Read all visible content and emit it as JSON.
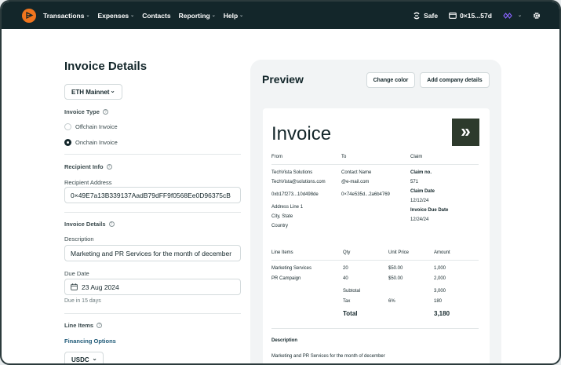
{
  "nav": {
    "items": [
      {
        "label": "Transactions"
      },
      {
        "label": "Expenses"
      },
      {
        "label": "Contacts"
      },
      {
        "label": "Reporting"
      },
      {
        "label": "Help"
      }
    ],
    "safe_label": "Safe",
    "wallet_label": "0×15...57d",
    "icons": [
      "logo-icon",
      "safe-icon",
      "wallet-icon",
      "chain-icon",
      "gear-icon"
    ],
    "accent": "#f0751e",
    "bar_color": "#13262a"
  },
  "form": {
    "title": "Invoice Details",
    "network": "ETH Mainnet",
    "invoice_type_label": "Invoice Type",
    "invoice_type_options": [
      "Offchain Invoice",
      "Onchain Invoice"
    ],
    "invoice_type_selected": "Onchain Invoice",
    "recipient_info_label": "Recipient Info",
    "recipient_address_label": "Recipient Address",
    "recipient_address": "0×49E7a13B339137AadB79dFF9f0568Ee0D96375cB",
    "invoice_details_label": "Invoice Details",
    "description_label": "Description",
    "description": "Marketing and PR Services for the month of december",
    "due_date_label": "Due Date",
    "due_date": "23 Aug 2024",
    "due_hint": "Due in 15 days",
    "line_items_label": "Line Items",
    "financing_label": "Financing Options",
    "currency": "USDC"
  },
  "preview": {
    "title": "Preview",
    "change_color": "Change color",
    "add_company": "Add company details",
    "invoice_heading": "Invoice",
    "from_label": "From",
    "to_label": "To",
    "claim_label": "Claim",
    "from": {
      "name": "TechVista Solutions",
      "email": "TechVista@solutions.com",
      "address": "0xb17f273...10d498de",
      "line1": "Address Line 1",
      "city": "City, State",
      "country": "Country"
    },
    "to": {
      "name": "Contact Name",
      "email": "@e-mail.com",
      "address": "0×74e535d...2a6b4769"
    },
    "claim": {
      "no_label": "Claim no.",
      "no": "571",
      "date_label": "Claim Date",
      "date": "12/12/24",
      "due_label": "Invoice Due Date",
      "due": "12/24/24"
    },
    "table": {
      "headers": [
        "Line Items",
        "Qty",
        "Unit Price",
        "Amount"
      ],
      "rows": [
        {
          "item": "Marketing Services",
          "qty": "20",
          "price": "$50.00",
          "amount": "1,000"
        },
        {
          "item": "PR Campaign",
          "qty": "40",
          "price": "$50.00",
          "amount": "2,000"
        }
      ],
      "subtotal_label": "Subtotal",
      "subtotal": "3,000",
      "tax_label": "Tax",
      "tax_rate": "6%",
      "tax": "180",
      "total_label": "Total",
      "total": "3,180"
    },
    "description_label": "Description",
    "description": "Marketing and PR Services for the month of december"
  }
}
